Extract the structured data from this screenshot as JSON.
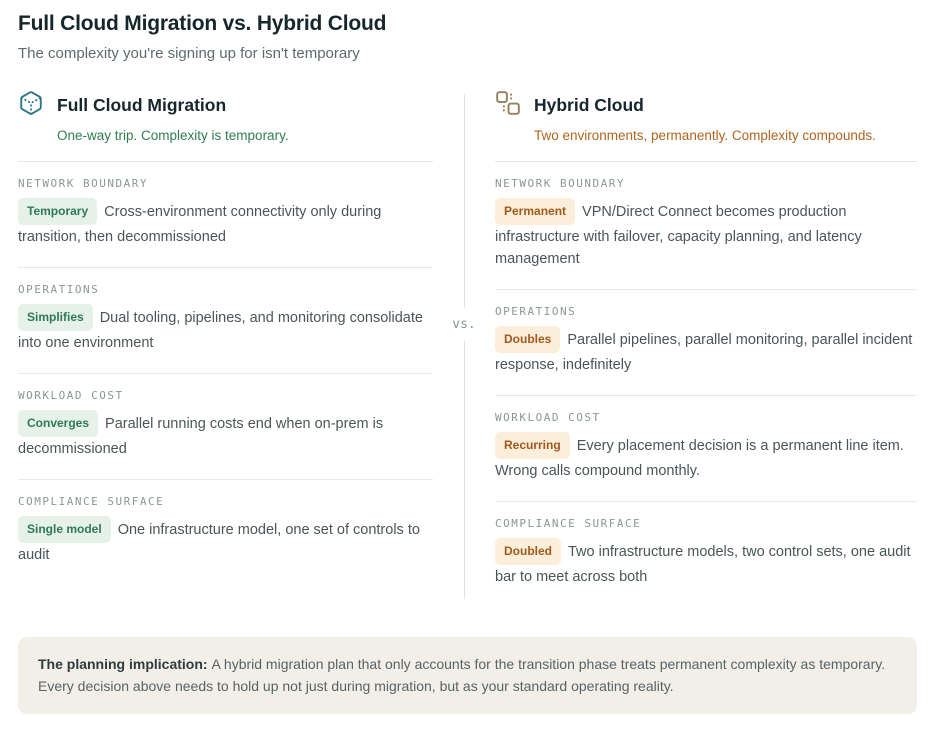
{
  "page": {
    "title": "Full Cloud Migration vs. Hybrid Cloud",
    "subtitle": "The complexity you're signing up for isn't temporary",
    "divider_label": "vs."
  },
  "colors": {
    "left_accent": "#2f7e53",
    "left_badge_bg": "#e6f1ea",
    "left_icon": "#2b7286",
    "right_accent": "#b0641f",
    "right_badge_bg": "#fbeedb",
    "right_icon": "#94825f",
    "callout_bg": "#f1efe8",
    "rule": "#e8eae9"
  },
  "columns": {
    "left": {
      "icon": "hexagon-box-icon",
      "title": "Full Cloud Migration",
      "tagline": "One-way trip. Complexity is temporary.",
      "rows": [
        {
          "label": "NETWORK BOUNDARY",
          "badge": "Temporary",
          "text": "Cross-environment connectivity only during transition, then decommissioned"
        },
        {
          "label": "OPERATIONS",
          "badge": "Simplifies",
          "text": "Dual tooling, pipelines, and monitoring consolidate into one environment"
        },
        {
          "label": "WORKLOAD COST",
          "badge": "Converges",
          "text": "Parallel running costs end when on-prem is decommissioned"
        },
        {
          "label": "COMPLIANCE SURFACE",
          "badge": "Single model",
          "text": "One infrastructure model, one set of controls to audit"
        }
      ]
    },
    "right": {
      "icon": "dual-squares-icon",
      "title": "Hybrid Cloud",
      "tagline": "Two environments, permanently. Complexity compounds.",
      "rows": [
        {
          "label": "NETWORK BOUNDARY",
          "badge": "Permanent",
          "text": "VPN/Direct Connect becomes production infrastructure with failover, capacity planning, and latency management"
        },
        {
          "label": "OPERATIONS",
          "badge": "Doubles",
          "text": "Parallel pipelines, parallel monitoring, parallel incident response, indefinitely"
        },
        {
          "label": "WORKLOAD COST",
          "badge": "Recurring",
          "text": "Every placement decision is a permanent line item. Wrong calls compound monthly."
        },
        {
          "label": "COMPLIANCE SURFACE",
          "badge": "Doubled",
          "text": "Two infrastructure models, two control sets, one audit bar to meet across both"
        }
      ]
    }
  },
  "callout": {
    "lead": "The planning implication:",
    "text": "A hybrid migration plan that only accounts for the transition phase treats permanent complexity as temporary. Every decision above needs to hold up not just during migration, but as your standard operating reality."
  }
}
